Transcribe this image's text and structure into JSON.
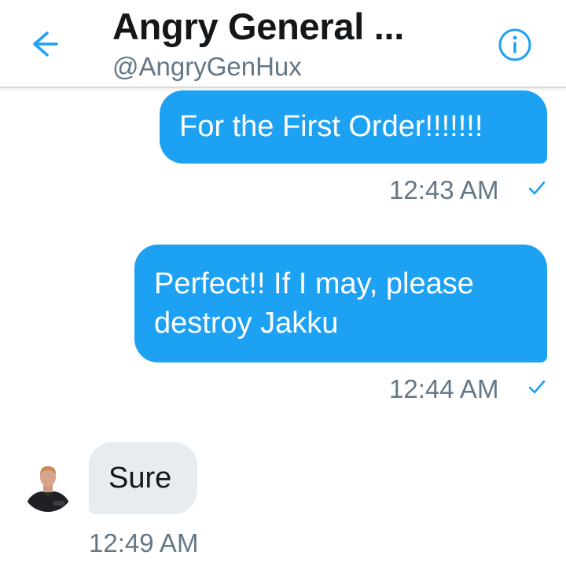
{
  "header": {
    "title": "Angry General ...",
    "handle": "@AngryGenHux",
    "back_icon": "back-arrow-icon",
    "info_icon": "info-icon"
  },
  "messages": [
    {
      "direction": "outgoing",
      "text": "For the First Order!!!!!!!",
      "time": "12:43 AM",
      "status_icon": "sent-check-icon"
    },
    {
      "direction": "outgoing",
      "text_lines": [
        "Perfect!! If I may, please",
        "destroy Jakku"
      ],
      "time": "12:44 AM",
      "status_icon": "sent-check-icon"
    },
    {
      "direction": "incoming",
      "text": "Sure",
      "time": "12:49 AM"
    }
  ],
  "colors": {
    "accent": "#1da1f2",
    "incoming_bubble": "#e6ecf0",
    "title_text": "#14171a",
    "secondary_text": "#657786"
  }
}
